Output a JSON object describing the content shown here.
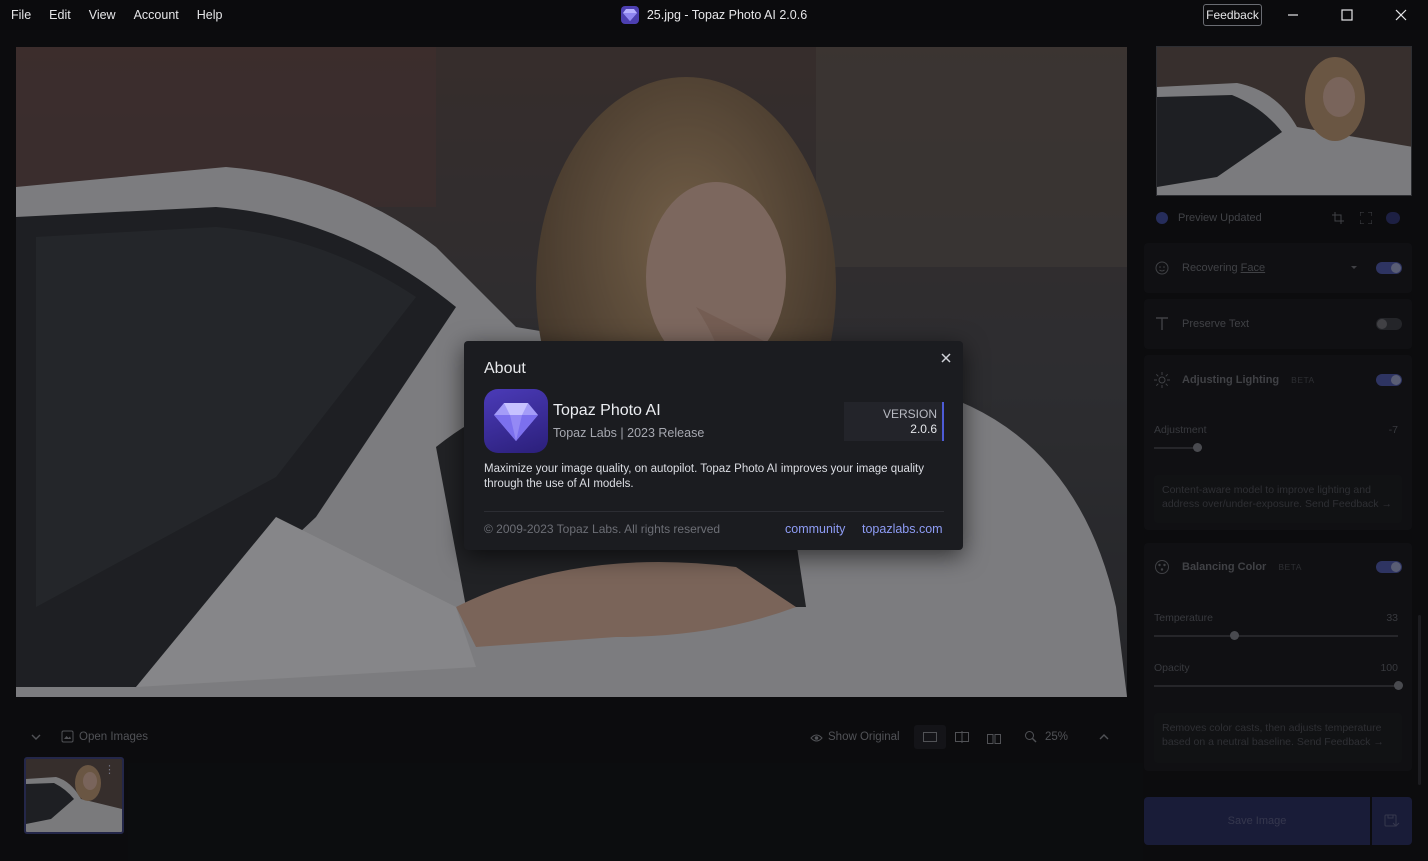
{
  "menu": [
    "File",
    "Edit",
    "View",
    "Account",
    "Help"
  ],
  "window": {
    "title": "25.jpg - Topaz Photo AI 2.0.6",
    "feedback_label": "Feedback"
  },
  "viewbar": {
    "open_images": "Open Images",
    "show_original": "Show Original",
    "zoom": "25%"
  },
  "panel": {
    "preview_status": "Preview Updated",
    "face": {
      "prefix": "Recovering ",
      "link": "Face"
    },
    "text": {
      "label": "Preserve Text"
    },
    "lighting": {
      "label": "Adjusting Lighting",
      "beta": "BETA",
      "adjustment_label": "Adjustment",
      "adjustment_value": "-7",
      "adjustment_level": 0.36,
      "description": "Content-aware model to improve lighting and address over/under-exposure. Send Feedback →"
    },
    "color": {
      "label": "Balancing Color",
      "beta": "BETA",
      "temperature_label": "Temperature",
      "temperature_value": "33",
      "temperature_level": 0.33,
      "opacity_label": "Opacity",
      "opacity_value": "100",
      "opacity_level": 1.0,
      "description": "Removes color casts, then adjusts temperature based on a neutral baseline. Send Feedback →"
    },
    "save_label": "Save Image"
  },
  "about": {
    "title": "About",
    "product": "Topaz Photo AI",
    "company": "Topaz Labs | 2023 Release",
    "version_label": "VERSION",
    "version": "2.0.6",
    "description": "Maximize your image quality, on autopilot. Topaz Photo AI improves your image quality through the use of AI models.",
    "copyright": "© 2009-2023 Topaz Labs. All rights reserved",
    "link_community": "community",
    "link_site": "topazlabs.com"
  },
  "colors": {
    "accent": "#4d5bd6",
    "link": "#8e9cf5",
    "dialog_bg": "#1b1c20",
    "app_bg": "#0d0e10"
  },
  "icons": {
    "app": "gem-icon",
    "close": "close-icon",
    "minimize": "minimize-icon",
    "maximize": "maximize-icon"
  }
}
